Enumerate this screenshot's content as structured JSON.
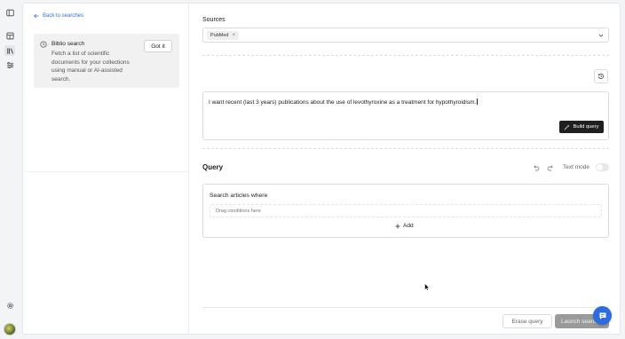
{
  "rail": {
    "icons": [
      "sidebar-toggle-icon",
      "documents-icon",
      "library-icon",
      "filters-icon",
      "settings-icon"
    ]
  },
  "left": {
    "back_label": "Back to searches",
    "info_title": "Biblio search",
    "info_text": "Fetch a list of scientific documents for your collections using manual or AI-assisted search.",
    "got_it": "Got it"
  },
  "sources": {
    "label": "Sources",
    "chips": [
      "PubMed"
    ],
    "chip_remove": "×"
  },
  "prompt": {
    "text": "I want recent (last 3 years) publications about the use of levothyroxine as a treatment for hypothyroidism.",
    "build_label": "Build query"
  },
  "query": {
    "title": "Query",
    "text_mode_label": "Text mode",
    "text_mode_on": false,
    "builder_title": "Search articles where",
    "dropzone_placeholder": "Drag conditions here",
    "add_label": "Add"
  },
  "footer": {
    "erase_label": "Erase query",
    "launch_label": "Launch search"
  },
  "colors": {
    "accent": "#2f6fd6",
    "fab": "#2d6cdf",
    "dark_button": "#1f1f1f",
    "disabled_button": "#9a9a9a"
  }
}
